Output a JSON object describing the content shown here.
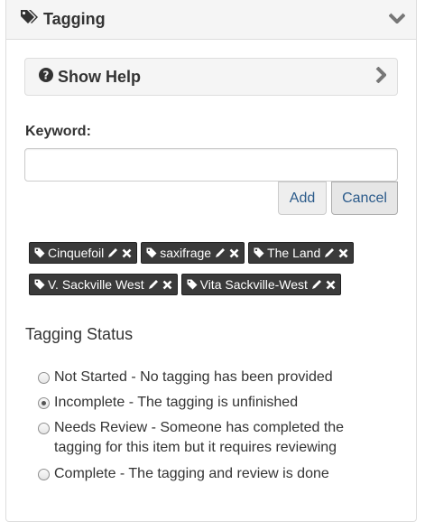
{
  "panel": {
    "title": "Tagging",
    "icon": "tags-icon",
    "collapse_icon": "chevron-down-icon"
  },
  "help": {
    "title": "Show Help",
    "icon": "question-circle-icon",
    "expand_icon": "chevron-right-icon"
  },
  "keyword": {
    "label": "Keyword:",
    "value": "",
    "placeholder": ""
  },
  "buttons": {
    "add": "Add",
    "cancel": "Cancel"
  },
  "tags": [
    {
      "label": "Cinquefoil"
    },
    {
      "label": "saxifrage"
    },
    {
      "label": "The Land"
    },
    {
      "label": "V. Sackville West"
    },
    {
      "label": "Vita Sackville-West"
    }
  ],
  "status": {
    "title": "Tagging Status",
    "options": [
      {
        "label": "Not Started - No tagging has been provided",
        "checked": false
      },
      {
        "label": "Incomplete - The tagging is unfinished",
        "checked": true
      },
      {
        "label": "Needs Review - Someone has completed the tagging for this item but it requires reviewing",
        "checked": false
      },
      {
        "label": "Complete - The tagging and review is done",
        "checked": false
      }
    ]
  },
  "colors": {
    "tag_bg": "#3a3a3a",
    "link": "#2a5a8a",
    "panel_bg": "#f5f5f5"
  }
}
